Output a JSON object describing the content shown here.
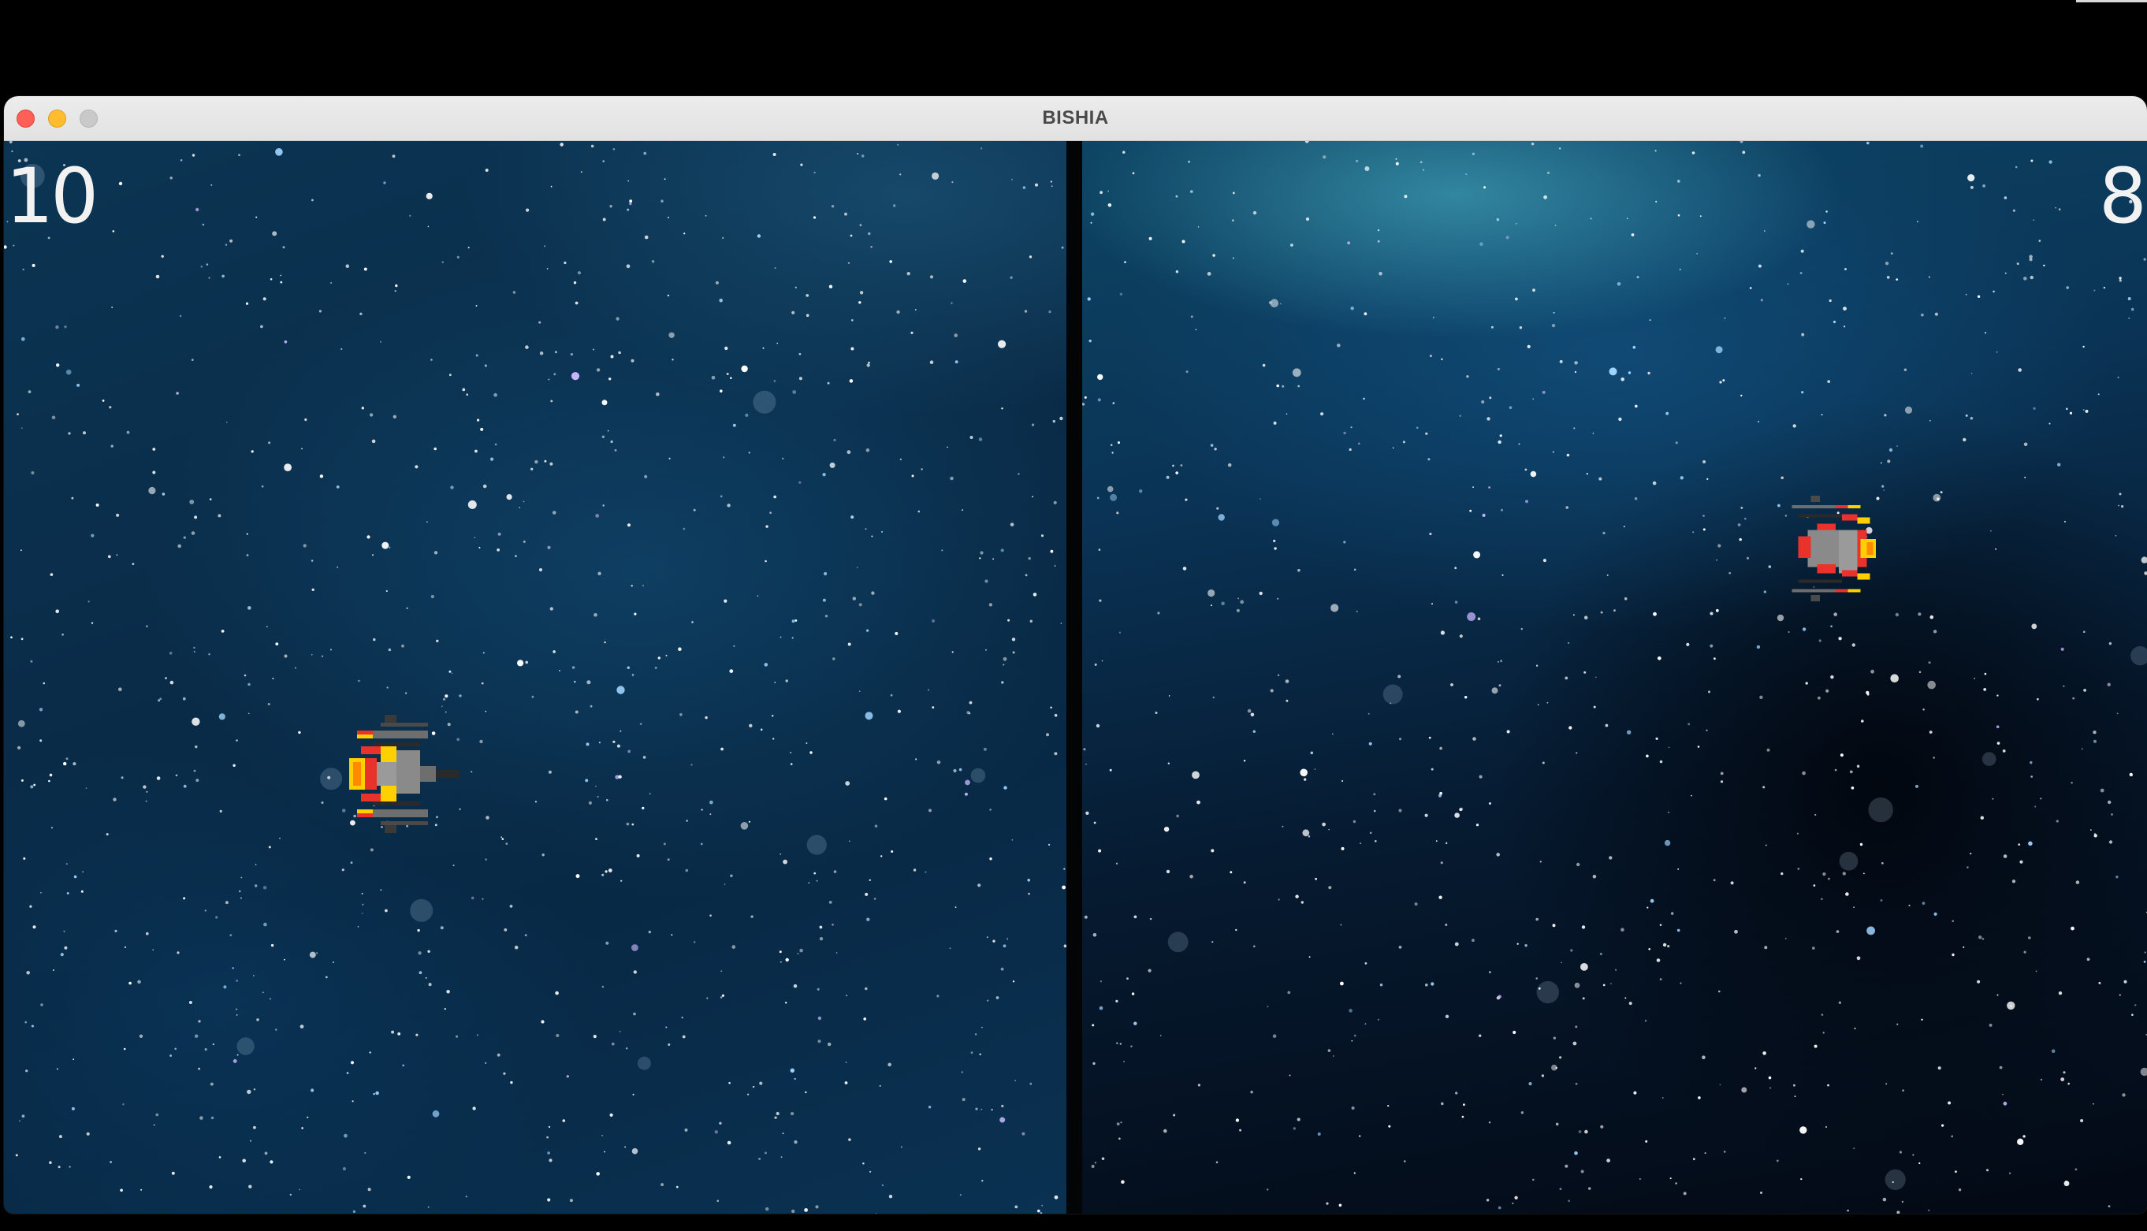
{
  "window": {
    "title": "BISHIA"
  },
  "players": {
    "left": {
      "score": "10",
      "ship_color": "#ffd000"
    },
    "right": {
      "score": "8",
      "ship_color": "#e8322a"
    }
  },
  "icons": {
    "close": "close-icon",
    "minimize": "minimize-icon",
    "maximize": "maximize-icon",
    "left_ship": "yellow-spaceship-icon",
    "right_ship": "red-spaceship-icon"
  },
  "colors": {
    "space_dark": "#082742",
    "space_teal": "#46aabe",
    "divider": "#030406",
    "titlebar": "#e6e6e6"
  }
}
